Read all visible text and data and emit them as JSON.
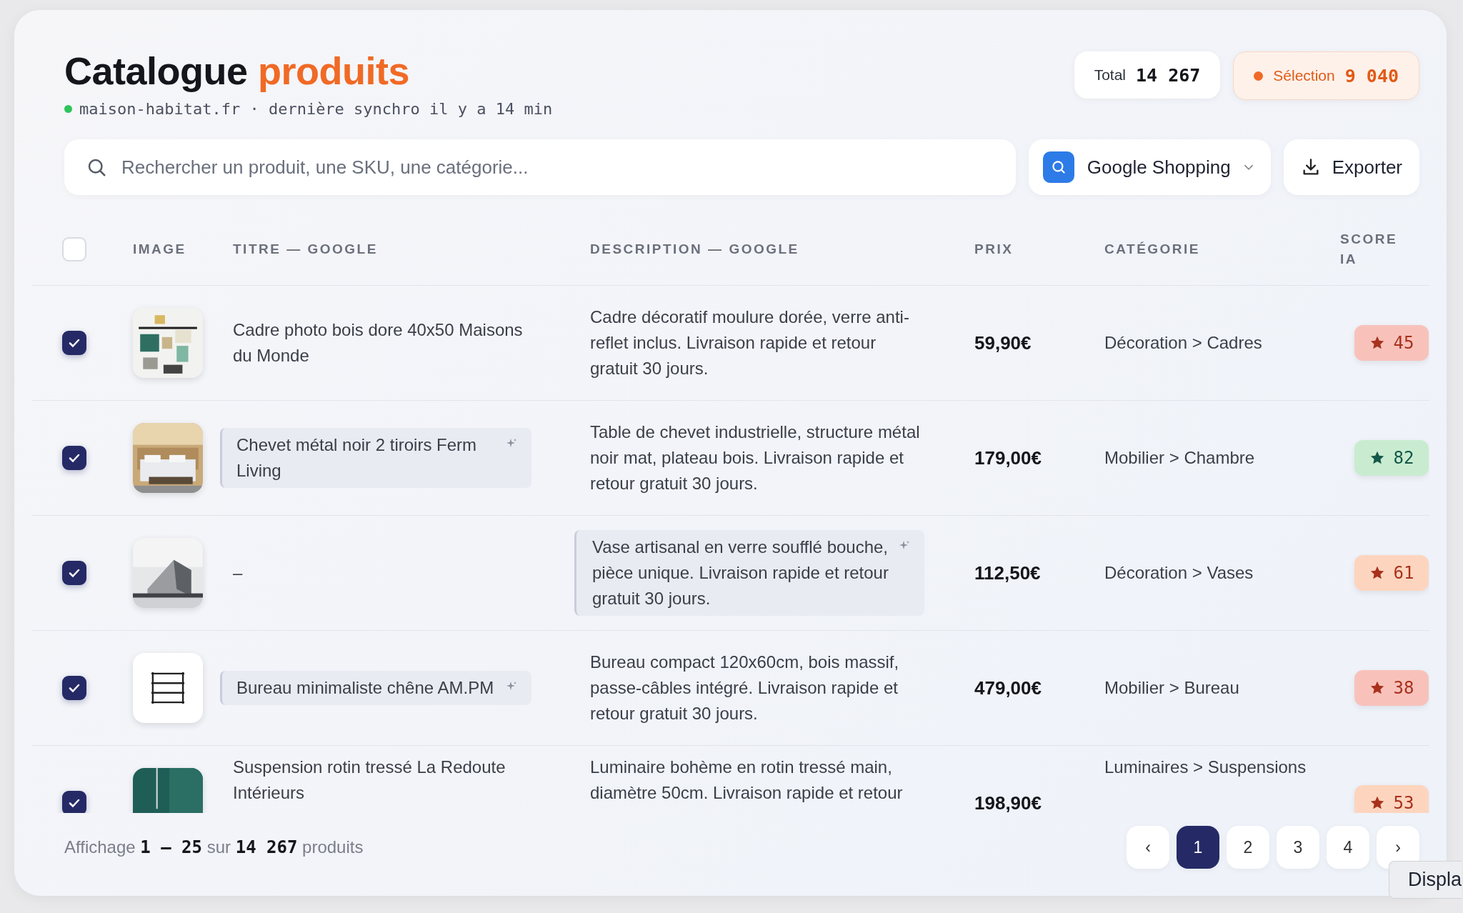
{
  "header": {
    "title": "Catalogue",
    "title_accent": "produits",
    "site": "maison-habitat.fr · dernière synchro il y a 14 min",
    "online": true,
    "total": {
      "label": "Total",
      "value": "14 267"
    },
    "selection": {
      "label": "Sélection",
      "value": "9 040"
    }
  },
  "search": {
    "placeholder": "Rechercher un produit, une SKU, une catégorie..."
  },
  "channel": {
    "label": "Google Shopping"
  },
  "export": {
    "label": "Exporter"
  },
  "table": {
    "all_selected": false,
    "columns": [
      "IMAGE",
      "TITRE — GOOGLE",
      "DESCRIPTION — GOOGLE",
      "PRIX",
      "CATÉGORIE",
      "SCORE IA"
    ],
    "rows": [
      {
        "selected": true,
        "title": "Cadre photo bois dore 40x50 Maisons du Monde",
        "title_ai": false,
        "description": "Cadre décoratif moulure dorée, verre anti-reflet inclus. Livraison rapide et retour gratuit 30 jours.",
        "description_ai": false,
        "price": "59,90€",
        "category": "Décoration > Cadres",
        "score": "45",
        "color": "#f8c2bb"
      },
      {
        "selected": true,
        "title": "Chevet métal noir 2 tiroirs Ferm Living",
        "title_ai": true,
        "description": "Table de chevet industrielle, structure métal noir mat, plateau bois. Livraison rapide et retour gratuit 30 jours.",
        "description_ai": false,
        "price": "179,00€",
        "category": "Mobilier > Chambre",
        "score": "82",
        "color": "#c9ecd0"
      },
      {
        "selected": true,
        "title": "–",
        "title_ai": false,
        "description": "Vase artisanal en verre soufflé bouche, pièce unique. Livraison rapide et retour gratuit 30 jours.",
        "description_ai": true,
        "price": "112,50€",
        "category": "Décoration > Vases",
        "score": "61",
        "color": "#fdd5bf"
      },
      {
        "selected": true,
        "thumb": {
          "kind": "icon"
        },
        "title": "Bureau minimaliste chêne AM.PM",
        "title_ai": true,
        "description": "Bureau compact 120x60cm, bois massif, passe-câbles intégré. Livraison rapide et retour gratuit 30 jours.",
        "description_ai": false,
        "price": "479,00€",
        "category": "Mobilier > Bureau",
        "score": "38",
        "color": "#f8c2bb"
      },
      {
        "selected": true,
        "title": "Suspension rotin tressé La Redoute Intérieurs",
        "title_ai": false,
        "description": "Luminaire bohème en rotin tressé main, diamètre 50cm. Livraison rapide et retour",
        "description_ai": false,
        "price": "198,90€",
        "category": "Luminaires > Suspensions",
        "score": "53",
        "color": "#fdd5bf"
      }
    ]
  },
  "footer": {
    "summary": "Affichage **1 – 25** sur **14 267** produits",
    "prev": "‹",
    "next": "›",
    "pages": [
      {
        "label": "1",
        "selected": true
      },
      {
        "label": "2",
        "selected": false
      },
      {
        "label": "3",
        "selected": false
      },
      {
        "label": "4",
        "selected": false
      }
    ]
  },
  "tooltip": "Displa"
}
